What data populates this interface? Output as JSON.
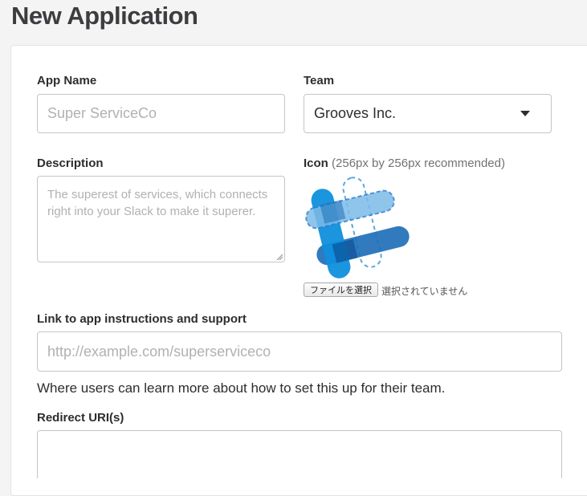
{
  "page": {
    "title": "New Application"
  },
  "form": {
    "app_name": {
      "label": "App Name",
      "placeholder": "Super ServiceCo"
    },
    "team": {
      "label": "Team",
      "value": "Grooves Inc."
    },
    "description": {
      "label": "Description",
      "placeholder": "The superest of services, which connects right into your Slack to make it superer."
    },
    "icon": {
      "label": "Icon",
      "hint": "(256px by 256px recommended)",
      "file_button_label": "ファイルを選択",
      "file_status": "選択されていません"
    },
    "link": {
      "label": "Link to app instructions and support",
      "placeholder": "http://example.com/superserviceco",
      "helper": "Where users can learn more about how to set this up for their team."
    },
    "redirect": {
      "label": "Redirect URI(s)",
      "value": ""
    }
  },
  "colors": {
    "icon_blue_dark": "#1f6fb8",
    "icon_blue_mid": "#0f8fdc",
    "icon_blue_light": "#7dbbe8",
    "icon_dashed": "#5aa8de"
  }
}
